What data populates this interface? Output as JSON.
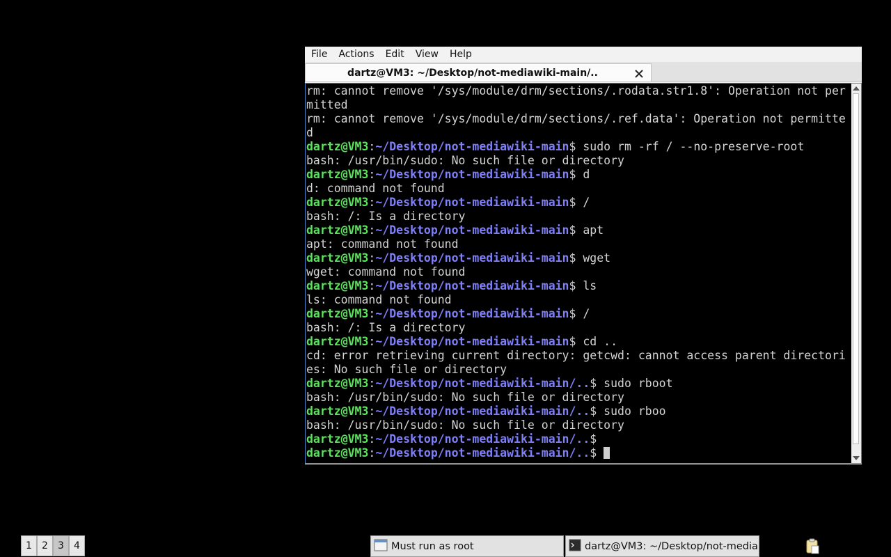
{
  "window": {
    "menu": [
      "File",
      "Actions",
      "Edit",
      "View",
      "Help"
    ],
    "tab_title": "dartz@VM3: ~/Desktop/not-mediawiki-main/.."
  },
  "terminal": {
    "lines": [
      {
        "type": "out",
        "text": "rm: cannot remove '/sys/module/drm/sections/.rodata.str1.8': Operation not per"
      },
      {
        "type": "out",
        "text": "mitted"
      },
      {
        "type": "out",
        "text": "rm: cannot remove '/sys/module/drm/sections/.ref.data': Operation not permitte"
      },
      {
        "type": "out",
        "text": "d"
      },
      {
        "type": "prompt",
        "user": "dartz@VM3",
        "path": "~/Desktop/not-mediawiki-main",
        "cmd": " sudo rm -rf / --no-preserve-root"
      },
      {
        "type": "out",
        "text": "bash: /usr/bin/sudo: No such file or directory"
      },
      {
        "type": "prompt",
        "user": "dartz@VM3",
        "path": "~/Desktop/not-mediawiki-main",
        "cmd": " d"
      },
      {
        "type": "out",
        "text": "d: command not found"
      },
      {
        "type": "prompt",
        "user": "dartz@VM3",
        "path": "~/Desktop/not-mediawiki-main",
        "cmd": " /"
      },
      {
        "type": "out",
        "text": "bash: /: Is a directory"
      },
      {
        "type": "prompt",
        "user": "dartz@VM3",
        "path": "~/Desktop/not-mediawiki-main",
        "cmd": " apt"
      },
      {
        "type": "out",
        "text": "apt: command not found"
      },
      {
        "type": "prompt",
        "user": "dartz@VM3",
        "path": "~/Desktop/not-mediawiki-main",
        "cmd": " wget"
      },
      {
        "type": "out",
        "text": "wget: command not found"
      },
      {
        "type": "prompt",
        "user": "dartz@VM3",
        "path": "~/Desktop/not-mediawiki-main",
        "cmd": " ls"
      },
      {
        "type": "out",
        "text": "ls: command not found"
      },
      {
        "type": "prompt",
        "user": "dartz@VM3",
        "path": "~/Desktop/not-mediawiki-main",
        "cmd": " /"
      },
      {
        "type": "out",
        "text": "bash: /: Is a directory"
      },
      {
        "type": "prompt",
        "user": "dartz@VM3",
        "path": "~/Desktop/not-mediawiki-main",
        "cmd": " cd .."
      },
      {
        "type": "out",
        "text": "cd: error retrieving current directory: getcwd: cannot access parent directori"
      },
      {
        "type": "out",
        "text": "es: No such file or directory"
      },
      {
        "type": "prompt",
        "user": "dartz@VM3",
        "path": "~/Desktop/not-mediawiki-main/..",
        "cmd": " sudo rboot"
      },
      {
        "type": "out",
        "text": "bash: /usr/bin/sudo: No such file or directory"
      },
      {
        "type": "prompt",
        "user": "dartz@VM3",
        "path": "~/Desktop/not-mediawiki-main/..",
        "cmd": " sudo rboo"
      },
      {
        "type": "out",
        "text": "bash: /usr/bin/sudo: No such file or directory"
      },
      {
        "type": "prompt",
        "user": "dartz@VM3",
        "path": "~/Desktop/not-mediawiki-main/..",
        "cmd": ""
      },
      {
        "type": "prompt",
        "user": "dartz@VM3",
        "path": "~/Desktop/not-mediawiki-main/..",
        "cmd": " ",
        "cursor": true
      }
    ]
  },
  "taskbar": {
    "workspaces": [
      "1",
      "2",
      "3",
      "4"
    ],
    "active_workspace": "3",
    "tasks": [
      {
        "label": "Must run as root",
        "icon": "window-icon"
      },
      {
        "label": "dartz@VM3: ~/Desktop/not-media...",
        "icon": "terminal-icon"
      }
    ],
    "tray_icon": "clipboard-icon"
  },
  "colors": {
    "prompt_user": "#5be25b",
    "prompt_path": "#7f7ff7",
    "terminal_text": "#d3d3d3",
    "terminal_bg": "#000000",
    "terminal_border": "#4a84c8"
  }
}
